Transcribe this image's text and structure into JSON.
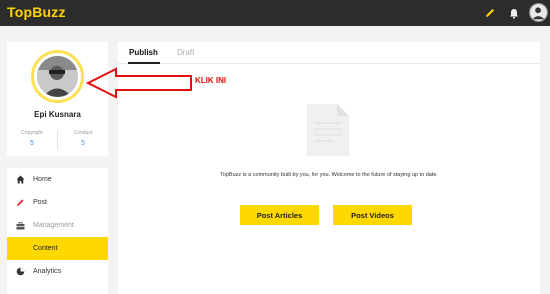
{
  "app": {
    "logo": "TopBuzz"
  },
  "header": {
    "icons": [
      "pencil-icon",
      "bell-icon",
      "avatar"
    ]
  },
  "profile": {
    "name": "Epi Kusnara",
    "stats": [
      {
        "label": "Copyright",
        "value": "5"
      },
      {
        "label": "Conduct",
        "value": "5"
      }
    ]
  },
  "sidebar": {
    "items": [
      {
        "label": "Home",
        "icon": "home-icon"
      },
      {
        "label": "Post",
        "icon": "pencil-icon"
      },
      {
        "label": "Management",
        "icon": "briefcase-icon"
      },
      {
        "label": "Content",
        "icon": ""
      },
      {
        "label": "Analytics",
        "icon": "pie-chart-icon"
      }
    ],
    "active": "Content"
  },
  "main": {
    "tabs": [
      {
        "label": "Publish",
        "active": true
      },
      {
        "label": "Draft",
        "active": false
      }
    ],
    "empty_message": "TopBuzz is a community built by you, for you. Welcome to the future of staying up to date.",
    "buttons": {
      "post_articles": "Post Articles",
      "post_videos": "Post Videos"
    }
  },
  "annotation": {
    "label": "KLIK INI"
  },
  "colors": {
    "brand_yellow": "#ffd800",
    "topbar": "#2c2c2c",
    "annotation_red": "#e01010",
    "stat_blue": "#4a8ad4"
  }
}
